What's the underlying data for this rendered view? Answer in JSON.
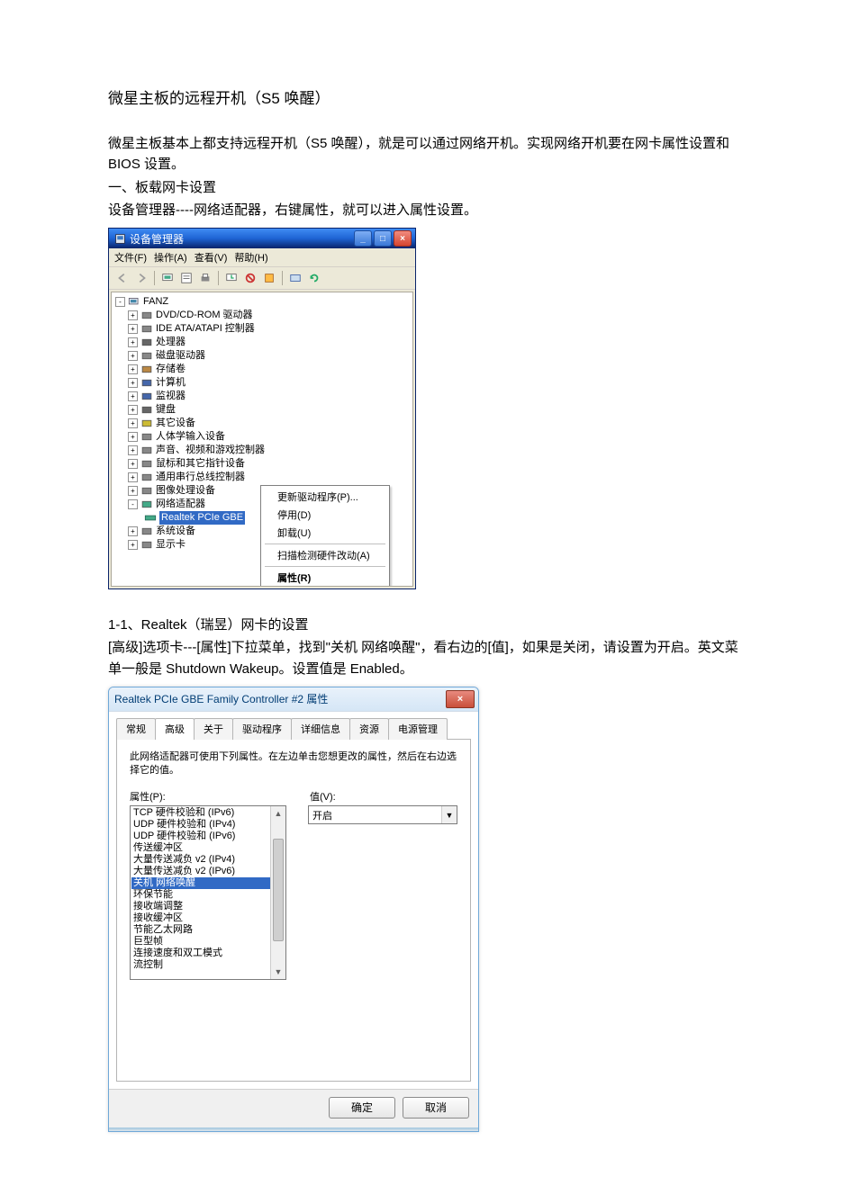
{
  "doc": {
    "title": "微星主板的远程开机（S5 唤醒）",
    "p1": "微星主板基本上都支持远程开机（S5 唤醒），就是可以通过网络开机。实现网络开机要在网卡属性设置和 BIOS 设置。",
    "p2": "一、板载网卡设置",
    "p3": "设备管理器----网络适配器，右键属性，就可以进入属性设置。",
    "h2": "1-1、Realtek（瑞昱）网卡的设置",
    "p4": "[高级]选项卡---[属性]下拉菜单，找到\"关机   网络唤醒\"，看右边的[值]，如果是关闭，请设置为开启。英文菜单一般是 Shutdown  Wakeup。设置值是 Enabled。"
  },
  "devmgr": {
    "window_title": "设备管理器",
    "menu": {
      "file": "文件(F)",
      "action": "操作(A)",
      "view": "查看(V)",
      "help": "帮助(H)"
    },
    "root": "FANZ",
    "nodes": [
      "DVD/CD-ROM 驱动器",
      "IDE ATA/ATAPI 控制器",
      "处理器",
      "磁盘驱动器",
      "存储卷",
      "计算机",
      "监视器",
      "键盘",
      "其它设备",
      "人体学输入设备",
      "声音、视频和游戏控制器",
      "鼠标和其它指针设备",
      "通用串行总线控制器",
      "图像处理设备",
      "网络适配器"
    ],
    "nic": "Realtek PCIe GBE",
    "after": [
      "系统设备",
      "显示卡"
    ],
    "context": {
      "update": "更新驱动程序(P)...",
      "disable": "停用(D)",
      "uninstall": "卸载(U)",
      "scan": "扫描检测硬件改动(A)",
      "properties": "属性(R)"
    }
  },
  "props": {
    "title": "Realtek PCIe GBE Family Controller #2 属性",
    "tabs": {
      "general": "常规",
      "advanced": "高级",
      "about": "关于",
      "driver": "驱动程序",
      "details": "详细信息",
      "resources": "资源",
      "power": "电源管理"
    },
    "desc": "此网络适配器可使用下列属性。在左边单击您想更改的属性，然后在右边选择它的值。",
    "label_property": "属性(P):",
    "label_value": "值(V):",
    "value": "开启",
    "items": [
      "TCP 硬件校验和 (IPv6)",
      "UDP 硬件校验和 (IPv4)",
      "UDP 硬件校验和 (IPv6)",
      "传送缓冲区",
      "大量传送减负 v2 (IPv4)",
      "大量传送减负 v2 (IPv6)",
      "关机 网络唤醒",
      "环保节能",
      "接收端调整",
      "接收缓冲区",
      "节能乙太网路",
      "巨型帧",
      "连接速度和双工模式",
      "流控制"
    ],
    "selected_index": 6,
    "ok": "确定",
    "cancel": "取消"
  }
}
